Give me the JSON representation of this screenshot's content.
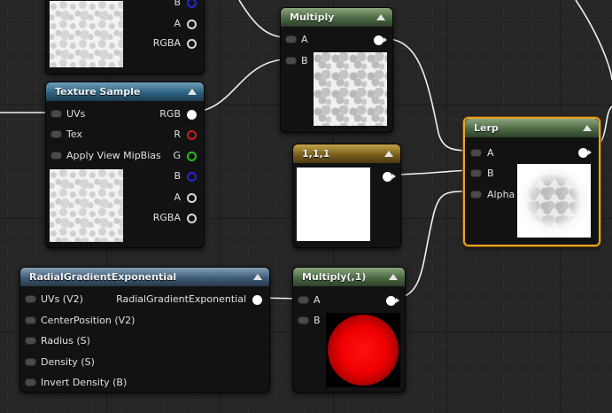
{
  "colors": {
    "selection": "#e8a326",
    "wire": "#f0f0f0",
    "pin_red": "#d11c1c",
    "pin_green": "#1ec01e",
    "pin_blue": "#2525e0"
  },
  "top_texture_node": {
    "pins": {
      "b": "B",
      "a": "A",
      "rgba": "RGBA"
    }
  },
  "texture_sample": {
    "title": "Texture Sample",
    "inputs": [
      "UVs",
      "Tex",
      "Apply View MipBias"
    ],
    "outputs": {
      "rgb": "RGB",
      "r": "R",
      "g": "G",
      "b": "B",
      "a": "A",
      "rgba": "RGBA"
    }
  },
  "multiply_top": {
    "title": "Multiply",
    "inputs": [
      "A",
      "B"
    ]
  },
  "constant": {
    "title": "1,1,1"
  },
  "lerp": {
    "title": "Lerp",
    "inputs": [
      "A",
      "B",
      "Alpha"
    ]
  },
  "radial_gradient": {
    "title": "RadialGradientExponential",
    "inputs": [
      "UVs (V2)",
      "CenterPosition (V2)",
      "Radius (S)",
      "Density (S)",
      "Invert Density (B)"
    ],
    "output": "RadialGradientExponential"
  },
  "multiply_bottom": {
    "title": "Multiply(,1)",
    "inputs": [
      "A",
      "B"
    ]
  }
}
